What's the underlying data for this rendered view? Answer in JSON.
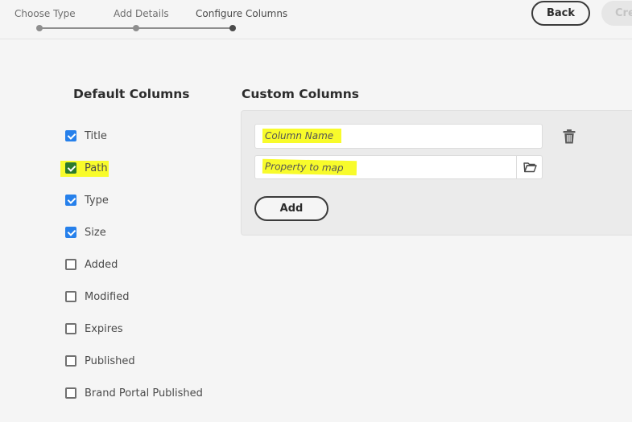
{
  "wizard": {
    "steps": [
      {
        "label": "Choose Type",
        "state": "done"
      },
      {
        "label": "Add Details",
        "state": "done"
      },
      {
        "label": "Configure Columns",
        "state": "current"
      }
    ],
    "back_label": "Back",
    "create_label": "Create"
  },
  "default_columns": {
    "title": "Default Columns",
    "items": [
      {
        "label": "Title",
        "checked": true
      },
      {
        "label": "Path",
        "checked": true,
        "highlighted": true
      },
      {
        "label": "Type",
        "checked": true
      },
      {
        "label": "Size",
        "checked": true
      },
      {
        "label": "Added",
        "checked": false
      },
      {
        "label": "Modified",
        "checked": false
      },
      {
        "label": "Expires",
        "checked": false
      },
      {
        "label": "Published",
        "checked": false
      },
      {
        "label": "Brand Portal Published",
        "checked": false
      }
    ]
  },
  "custom_columns": {
    "title": "Custom Columns",
    "column_name_placeholder": "Column Name",
    "property_placeholder": "Property to map",
    "add_label": "Add",
    "icons": {
      "delete": "trash-icon",
      "browse": "folder-icon"
    }
  },
  "colors": {
    "accent": "#2680eb",
    "highlight": "#f8fb2b",
    "highlight_check": "#2c7a2c"
  }
}
